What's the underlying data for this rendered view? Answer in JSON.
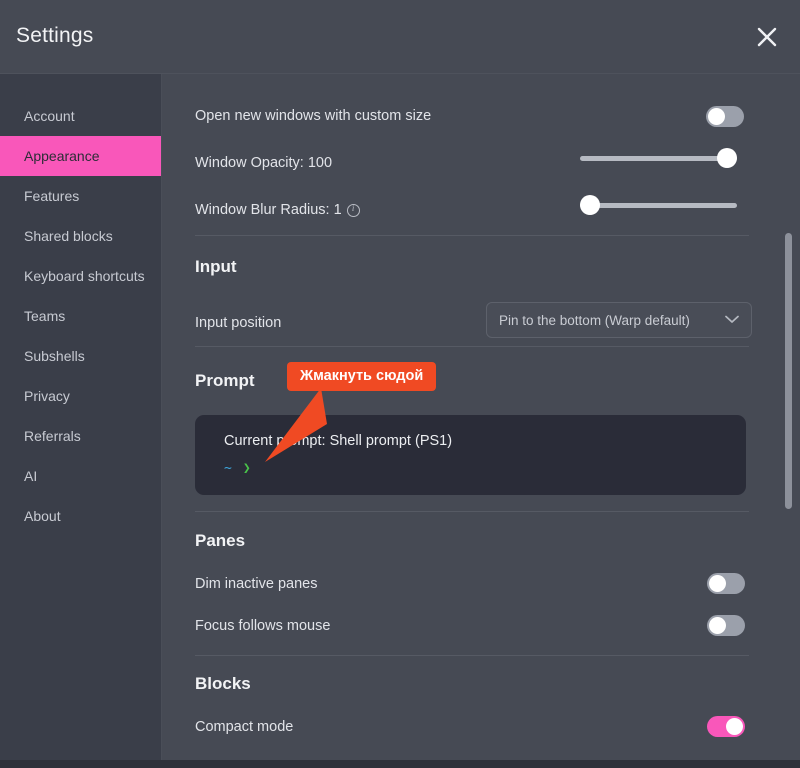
{
  "window": {
    "title": "Settings",
    "close_icon": "close-icon"
  },
  "sidebar": {
    "items": [
      {
        "label": "Account",
        "selected": false
      },
      {
        "label": "Appearance",
        "selected": true
      },
      {
        "label": "Features",
        "selected": false
      },
      {
        "label": "Shared blocks",
        "selected": false
      },
      {
        "label": "Keyboard shortcuts",
        "selected": false
      },
      {
        "label": "Teams",
        "selected": false
      },
      {
        "label": "Subshells",
        "selected": false
      },
      {
        "label": "Privacy",
        "selected": false
      },
      {
        "label": "Referrals",
        "selected": false
      },
      {
        "label": "AI",
        "selected": false
      },
      {
        "label": "About",
        "selected": false
      }
    ]
  },
  "main": {
    "window_section": {
      "custom_size": {
        "label": "Open new windows with custom size",
        "toggle_state": "off"
      },
      "opacity": {
        "label": "Window Opacity: 100",
        "value": 100,
        "min": 0,
        "max": 100,
        "fill_percent": 100
      },
      "blur_radius": {
        "label": "Window Blur Radius: 1",
        "value": 1,
        "min": 0,
        "max": 100,
        "fill_percent": 0,
        "info_icon": "info-icon"
      }
    },
    "input_section": {
      "title": "Input",
      "position": {
        "label": "Input position",
        "selected_value": "Pin to the bottom (Warp default)",
        "chevron_icon": "chevron-down-icon"
      }
    },
    "prompt_section": {
      "title": "Prompt",
      "current_prompt_label": "Current prompt: Shell prompt (PS1)",
      "sample_tilde": "~",
      "sample_chevron": "❯"
    },
    "panes_section": {
      "title": "Panes",
      "dim_inactive": {
        "label": "Dim inactive panes",
        "toggle_state": "off"
      },
      "focus_follows_mouse": {
        "label": "Focus follows mouse",
        "toggle_state": "off"
      }
    },
    "blocks_section": {
      "title": "Blocks",
      "compact_mode": {
        "label": "Compact mode",
        "toggle_state": "on"
      }
    }
  },
  "annotation": {
    "callout_text": "Жмакнуть сюдой"
  },
  "colors": {
    "accent_pink": "#f957ba",
    "callout_orange": "#f04a23",
    "window_bg": "#464a54",
    "sidebar_bg": "#3a3e49",
    "prompt_bg": "#2a2c38",
    "prompt_tilde": "#3ea8e0",
    "prompt_chevron": "#49c34a"
  }
}
